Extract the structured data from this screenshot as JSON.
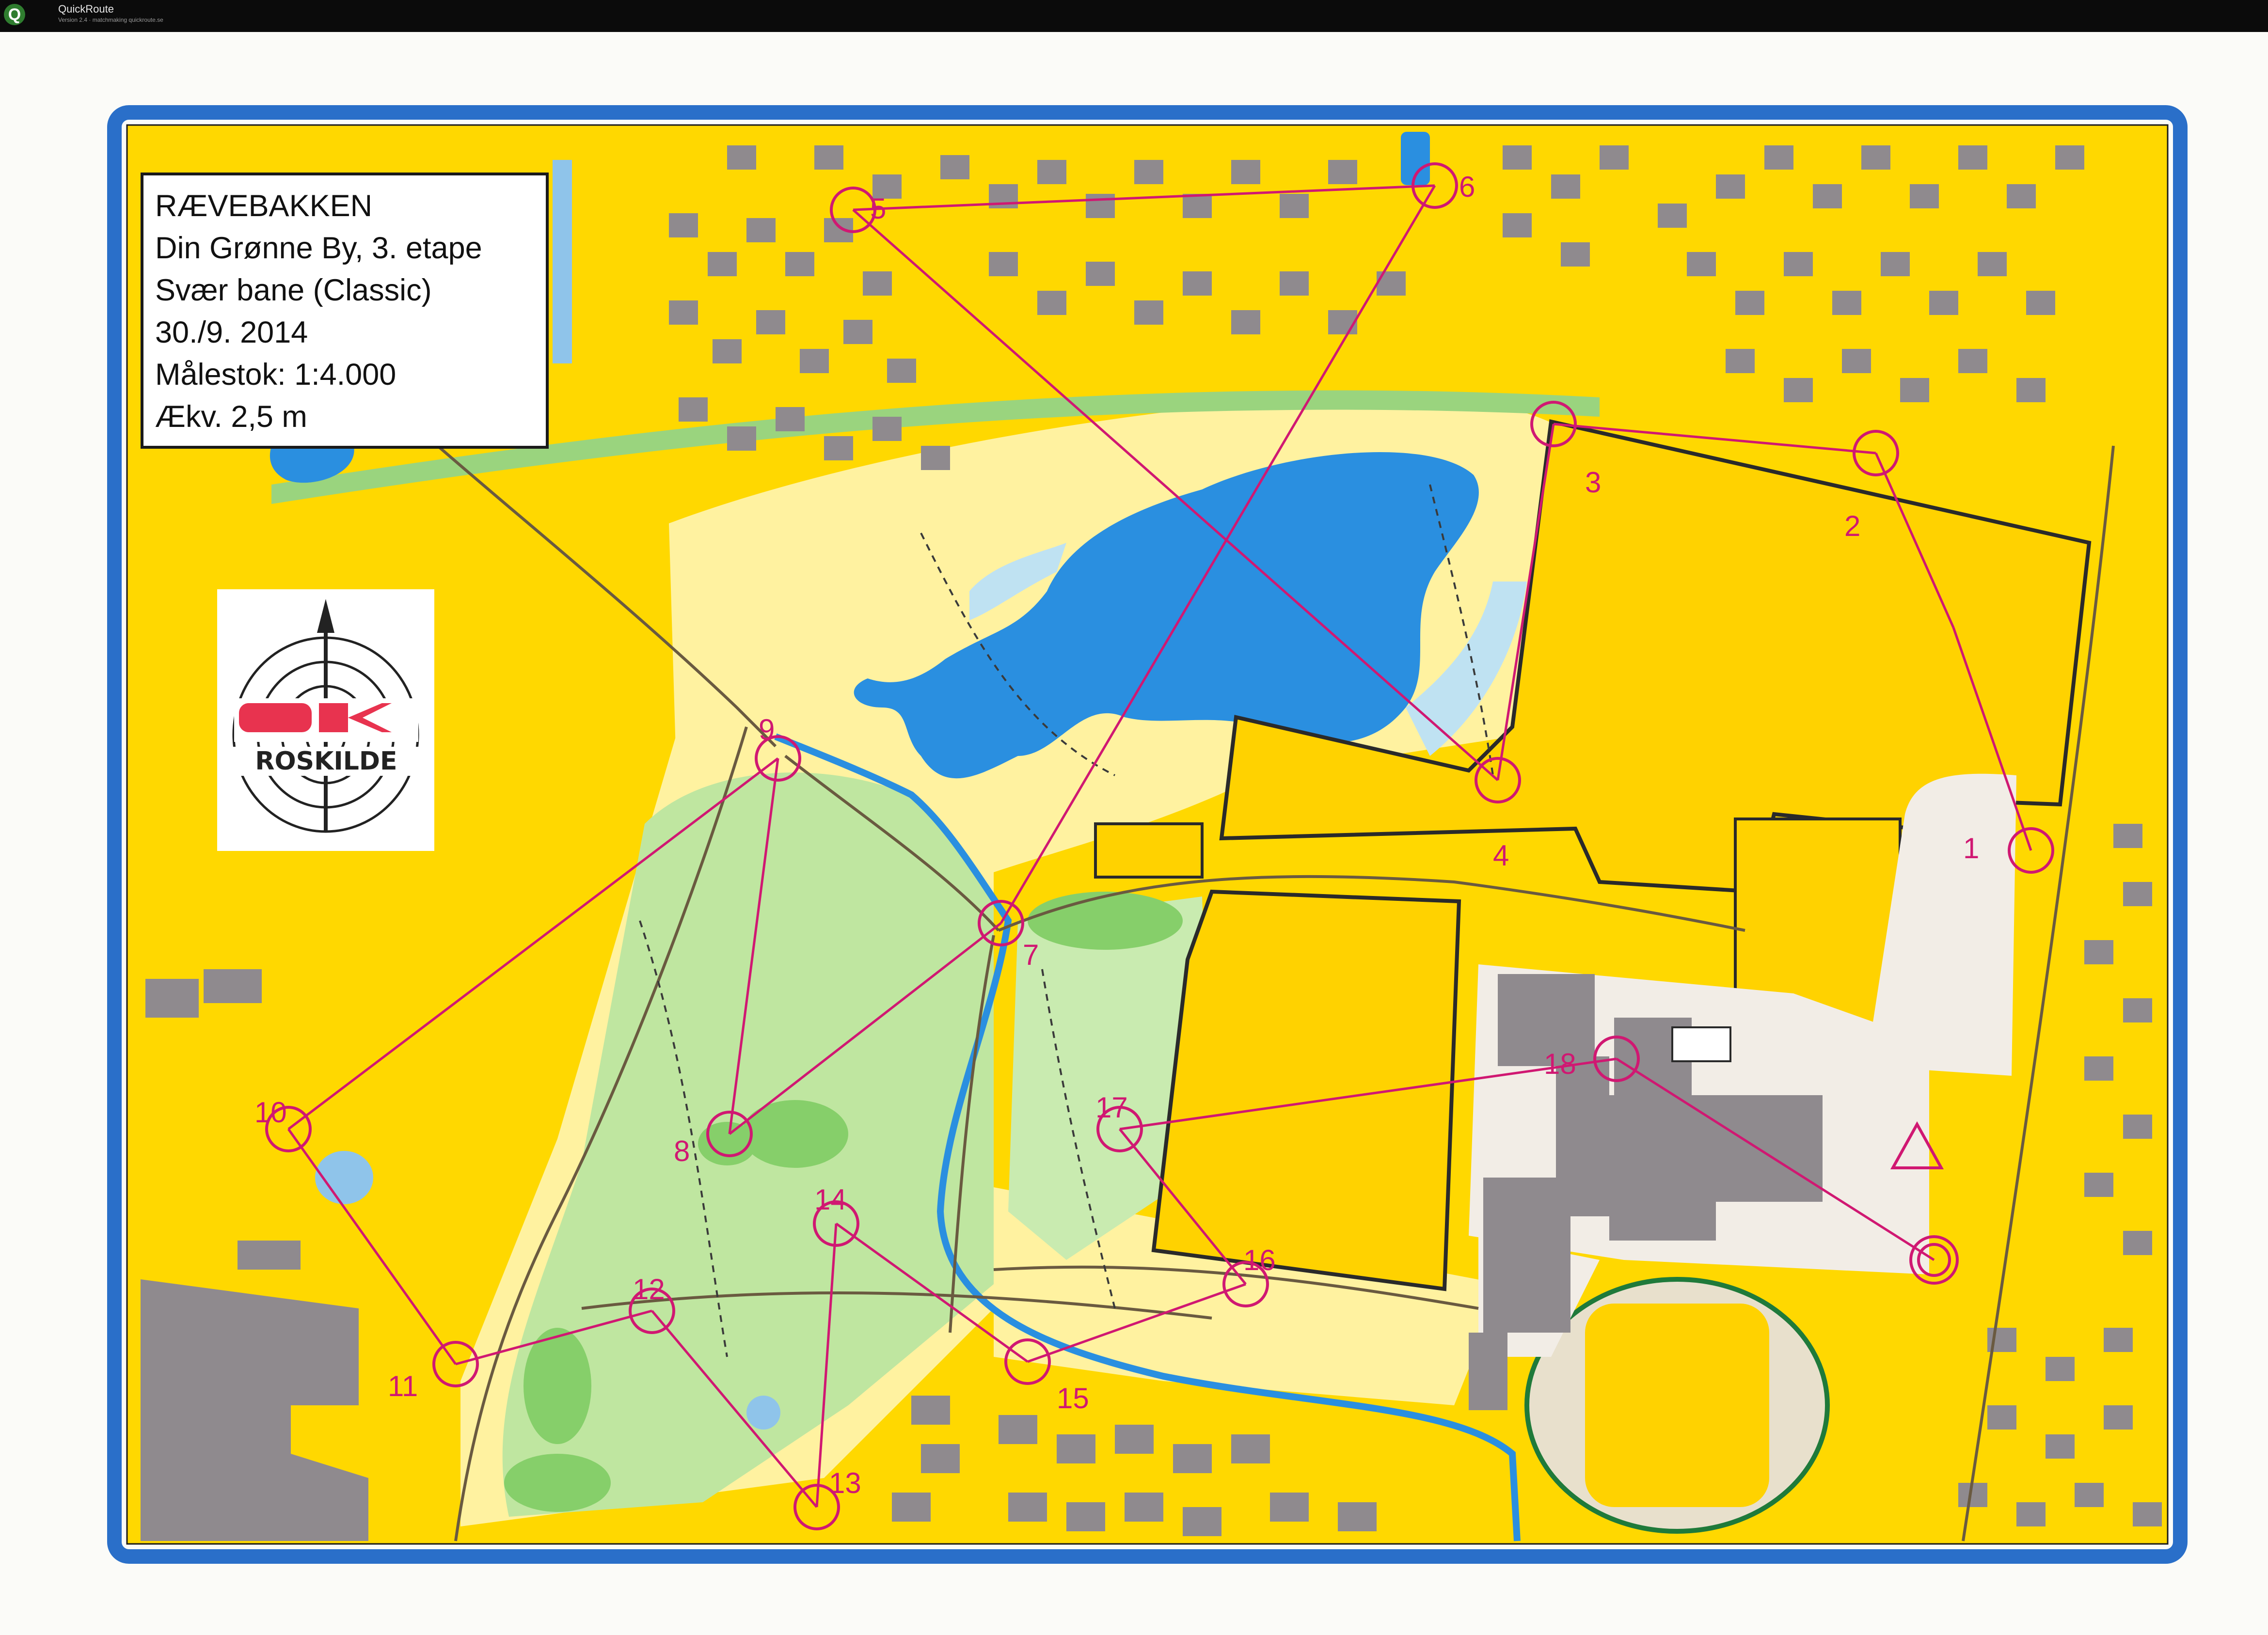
{
  "window": {
    "app_name": "QuickRoute",
    "app_subtitle": "Version 2.4 · matchmaking quickroute.se"
  },
  "map_info": {
    "lines": [
      "RÆVEBAKKEN",
      "Din Grønne By, 3. etape",
      "Svær bane (Classic)",
      "30./9. 2014",
      "Målestok: 1:4.000",
      "Ækv. 2,5 m"
    ]
  },
  "logo": {
    "text": "ROSKILDE",
    "letters": "OK"
  },
  "course": {
    "color": "#d01872",
    "controls": [
      "1",
      "2",
      "3",
      "4",
      "5",
      "6",
      "7",
      "8",
      "9",
      "10",
      "11",
      "12",
      "13",
      "14",
      "15",
      "16",
      "17",
      "18"
    ]
  },
  "colors": {
    "frame": "#2a6fc9",
    "open_land": "#ffd800",
    "rough_open": "#fff2a0",
    "forest_light": "#bfe6a0",
    "forest_green": "#86cf6a",
    "water": "#2a8fe0",
    "building": "#8f8a8e",
    "paved": "#efe7d6",
    "course": "#d01872"
  }
}
